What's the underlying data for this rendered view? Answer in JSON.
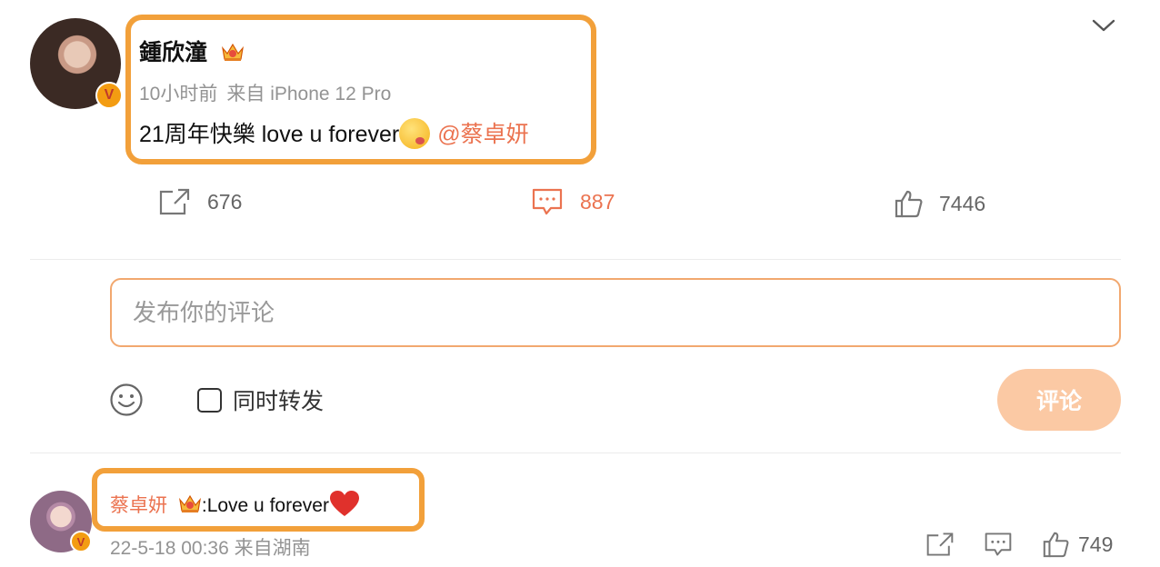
{
  "post": {
    "author": "鍾欣潼",
    "time": "10小时前",
    "source": "来自 iPhone 12 Pro",
    "text": "21周年快樂 love u forever",
    "mention": "@蔡卓妍"
  },
  "stats": {
    "reposts": "676",
    "comments": "887",
    "likes": "7446"
  },
  "comment_box": {
    "placeholder": "发布你的评论",
    "repost_checkbox_label": "同时转发",
    "submit_label": "评论"
  },
  "reply": {
    "author": "蔡卓妍",
    "separator": ":",
    "text": "Love u forever",
    "time": "22-5-18 00:36",
    "location": "来自湖南",
    "likes": "749"
  },
  "colors": {
    "accent": "#eb7350",
    "highlight": "#f2a03a",
    "button_disabled": "#fbc9a4",
    "muted_text": "#939393"
  },
  "icons": [
    "chevron-down-icon",
    "verified-badge-icon",
    "crown-icon",
    "kiss-emoji-icon",
    "repost-icon",
    "comment-icon",
    "like-icon",
    "smile-icon",
    "heart-icon"
  ]
}
